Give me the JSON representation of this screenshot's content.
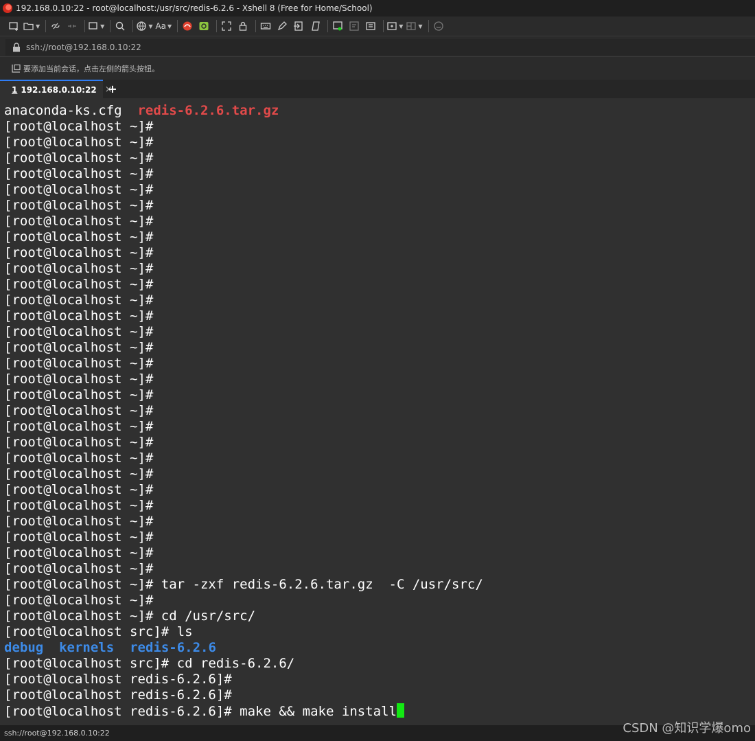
{
  "window": {
    "title": "192.168.0.10:22 - root@localhost:/usr/src/redis-6.2.6 - Xshell 8 (Free for Home/School)"
  },
  "toolbar": {
    "icons": [
      "new-session-icon",
      "open-folder-icon",
      "reconnect-icon",
      "disconnect-icon",
      "new-window-icon",
      "search-icon",
      "globe-icon",
      "font-icon",
      "xftp-icon",
      "xagent-icon",
      "fullscreen-icon",
      "lock-icon",
      "keyboard-icon",
      "highlight-icon",
      "transfer-icon",
      "script-icon",
      "compose-icon",
      "compose-bar-icon",
      "quick-command-icon",
      "add-tab-group-icon",
      "layout-icon",
      "chat-icon"
    ],
    "font_label": "Aa"
  },
  "address": {
    "value": "ssh://root@192.168.0.10:22"
  },
  "notice": {
    "text": "要添加当前会话，点击左侧的箭头按钮。"
  },
  "tabs": [
    {
      "number": "1",
      "label": "192.168.0.10:22",
      "active": true
    }
  ],
  "terminal": {
    "lines": [
      [
        {
          "t": "anaconda-ks.cfg  ",
          "c": ""
        },
        {
          "t": "redis-6.2.6.tar.gz",
          "c": "red"
        }
      ],
      [
        {
          "t": "[root@localhost ~]#",
          "c": ""
        }
      ],
      [
        {
          "t": "[root@localhost ~]#",
          "c": ""
        }
      ],
      [
        {
          "t": "[root@localhost ~]#",
          "c": ""
        }
      ],
      [
        {
          "t": "[root@localhost ~]#",
          "c": ""
        }
      ],
      [
        {
          "t": "[root@localhost ~]#",
          "c": ""
        }
      ],
      [
        {
          "t": "[root@localhost ~]#",
          "c": ""
        }
      ],
      [
        {
          "t": "[root@localhost ~]#",
          "c": ""
        }
      ],
      [
        {
          "t": "[root@localhost ~]#",
          "c": ""
        }
      ],
      [
        {
          "t": "[root@localhost ~]#",
          "c": ""
        }
      ],
      [
        {
          "t": "[root@localhost ~]#",
          "c": ""
        }
      ],
      [
        {
          "t": "[root@localhost ~]#",
          "c": ""
        }
      ],
      [
        {
          "t": "[root@localhost ~]#",
          "c": ""
        }
      ],
      [
        {
          "t": "[root@localhost ~]#",
          "c": ""
        }
      ],
      [
        {
          "t": "[root@localhost ~]#",
          "c": ""
        }
      ],
      [
        {
          "t": "[root@localhost ~]#",
          "c": ""
        }
      ],
      [
        {
          "t": "[root@localhost ~]#",
          "c": ""
        }
      ],
      [
        {
          "t": "[root@localhost ~]#",
          "c": ""
        }
      ],
      [
        {
          "t": "[root@localhost ~]#",
          "c": ""
        }
      ],
      [
        {
          "t": "[root@localhost ~]#",
          "c": ""
        }
      ],
      [
        {
          "t": "[root@localhost ~]#",
          "c": ""
        }
      ],
      [
        {
          "t": "[root@localhost ~]#",
          "c": ""
        }
      ],
      [
        {
          "t": "[root@localhost ~]#",
          "c": ""
        }
      ],
      [
        {
          "t": "[root@localhost ~]#",
          "c": ""
        }
      ],
      [
        {
          "t": "[root@localhost ~]#",
          "c": ""
        }
      ],
      [
        {
          "t": "[root@localhost ~]#",
          "c": ""
        }
      ],
      [
        {
          "t": "[root@localhost ~]#",
          "c": ""
        }
      ],
      [
        {
          "t": "[root@localhost ~]#",
          "c": ""
        }
      ],
      [
        {
          "t": "[root@localhost ~]#",
          "c": ""
        }
      ],
      [
        {
          "t": "[root@localhost ~]#",
          "c": ""
        }
      ],
      [
        {
          "t": "[root@localhost ~]# tar -zxf redis-6.2.6.tar.gz  -C /usr/src/",
          "c": ""
        }
      ],
      [
        {
          "t": "[root@localhost ~]#",
          "c": ""
        }
      ],
      [
        {
          "t": "[root@localhost ~]# cd /usr/src/",
          "c": ""
        }
      ],
      [
        {
          "t": "[root@localhost src]# ls",
          "c": ""
        }
      ],
      [
        {
          "t": "debug",
          "c": "blue"
        },
        {
          "t": "  ",
          "c": ""
        },
        {
          "t": "kernels",
          "c": "blue"
        },
        {
          "t": "  ",
          "c": ""
        },
        {
          "t": "redis-6.2.6",
          "c": "blue"
        }
      ],
      [
        {
          "t": "[root@localhost src]# cd redis-6.2.6/",
          "c": ""
        }
      ],
      [
        {
          "t": "[root@localhost redis-6.2.6]#",
          "c": ""
        }
      ],
      [
        {
          "t": "[root@localhost redis-6.2.6]#",
          "c": ""
        }
      ],
      [
        {
          "t": "[root@localhost redis-6.2.6]# make && make install",
          "c": ""
        }
      ]
    ],
    "colors": {
      "red": "#e24a4a",
      "blue": "#3d8be8",
      "cursor": "#13e813",
      "bg": "#303030"
    }
  },
  "status": {
    "text": "ssh://root@192.168.0.10:22"
  },
  "watermark": {
    "text": "CSDN @知识学爆omo"
  }
}
